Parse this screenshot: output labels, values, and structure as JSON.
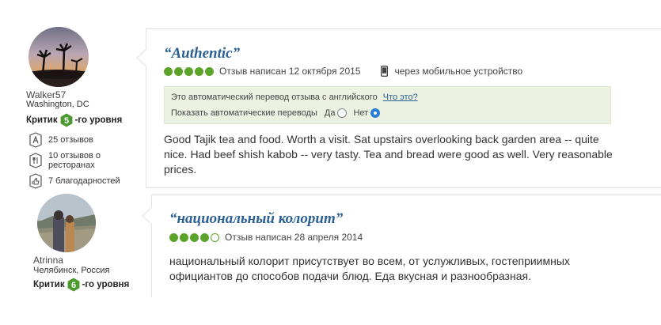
{
  "reviews": [
    {
      "reviewer": {
        "name": "Walker57",
        "location": "Washington, DC",
        "level_prefix": "Критик",
        "level_num": "5",
        "level_suffix": "-го уровня",
        "stats": [
          {
            "icon": "pencil-icon",
            "text": "25 отзывов"
          },
          {
            "icon": "fork-knife-icon",
            "text": "10 отзывов о ресторанах"
          },
          {
            "icon": "thumbs-up-icon",
            "text": "7 благодарностей"
          }
        ]
      },
      "title": "“Authentic”",
      "rating": 5,
      "rating_max": 5,
      "date": "Отзыв написан 12 октября 2015",
      "via": "через мобильное устройство",
      "translation": {
        "notice": "Это автоматический перевод отзыва с английского",
        "what_link": "Что это?",
        "show_label": "Показать автоматические переводы",
        "yes_label": "Да",
        "no_label": "Нет",
        "selected": "Нет"
      },
      "text": "Good Tajik tea and food. Worth a visit. Sat upstairs overlooking back garden area -- quite nice. Had beef shish kabob -- very tasty. Tea and bread were good as well. Very reasonable prices."
    },
    {
      "reviewer": {
        "name": "Atrinna",
        "location": "Челябинск, Россия",
        "level_prefix": "Критик",
        "level_num": "6",
        "level_suffix": "-го уровня"
      },
      "title": "“национальный колорит”",
      "rating": 4,
      "rating_max": 5,
      "date": "Отзыв написан 28 апреля 2014",
      "text": "национальный колорит присутствует во всем, от услужливых, гостеприимных официантов до способов подачи блюд. Еда вкусная и разнообразная."
    }
  ],
  "colors": {
    "rating_green": "#5ba32b",
    "title_blue": "#2b6095",
    "badge_green": "#4a9a2e",
    "translation_bg": "#ecf2e1",
    "radio_selected": "#2a7fd4"
  }
}
